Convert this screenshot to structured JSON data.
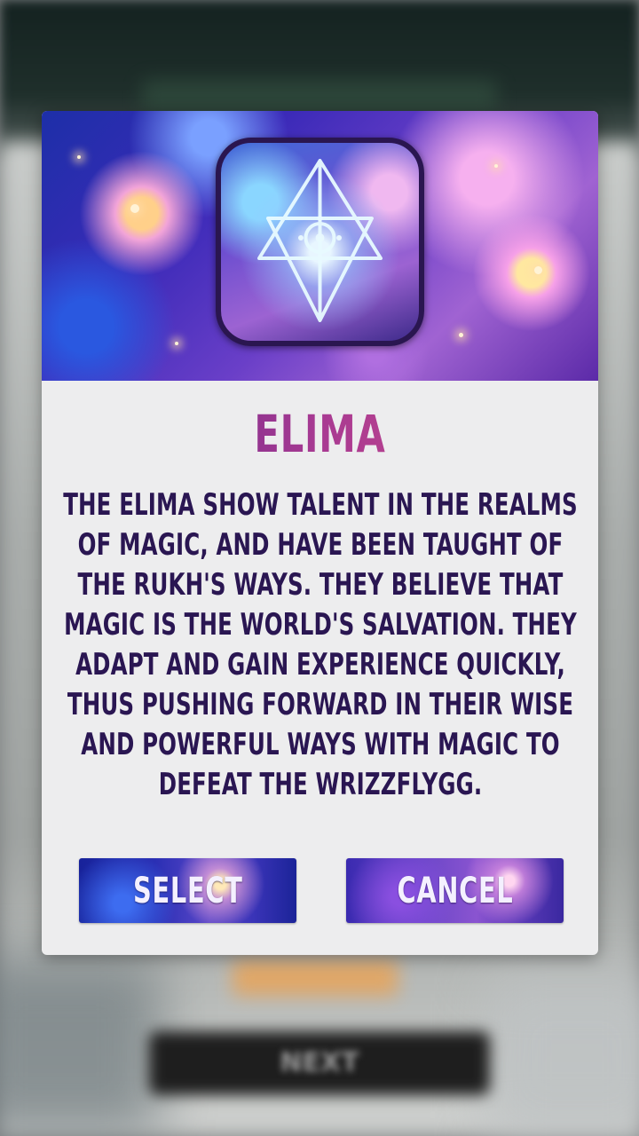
{
  "dialog": {
    "title": "ELIMA",
    "description": "THE ELIMA SHOW TALENT IN THE REALMS OF MAGIC, AND HAVE BEEN TAUGHT OF THE RUKH'S WAYS. THEY BELIEVE THAT MAGIC IS THE WORLD'S SALVATION. THEY ADAPT AND GAIN EXPERIENCE QUICKLY, THUS PUSHING FORWARD IN THEIR WISE AND POWERFUL WAYS WITH MAGIC TO DEFEAT THE WRIZZFLYGG.",
    "select_label": "SELECT",
    "cancel_label": "CANCEL",
    "icon": "elima-sigil-icon"
  },
  "background": {
    "next_label": "NEXT"
  },
  "colors": {
    "title_gradient_start": "#6b2a8c",
    "title_gradient_end": "#c84a8a",
    "description_text": "#2a1652",
    "dialog_bg": "#ededee",
    "button_text": "#f4f0ff"
  }
}
